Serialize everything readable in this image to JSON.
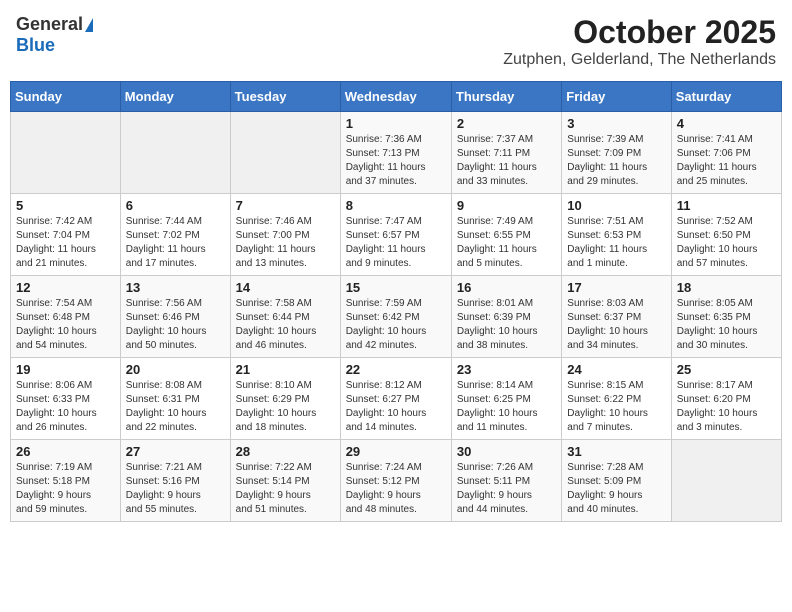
{
  "logo": {
    "general": "General",
    "blue": "Blue"
  },
  "title": "October 2025",
  "subtitle": "Zutphen, Gelderland, The Netherlands",
  "days_of_week": [
    "Sunday",
    "Monday",
    "Tuesday",
    "Wednesday",
    "Thursday",
    "Friday",
    "Saturday"
  ],
  "weeks": [
    [
      {
        "day": "",
        "info": ""
      },
      {
        "day": "",
        "info": ""
      },
      {
        "day": "",
        "info": ""
      },
      {
        "day": "1",
        "info": "Sunrise: 7:36 AM\nSunset: 7:13 PM\nDaylight: 11 hours\nand 37 minutes."
      },
      {
        "day": "2",
        "info": "Sunrise: 7:37 AM\nSunset: 7:11 PM\nDaylight: 11 hours\nand 33 minutes."
      },
      {
        "day": "3",
        "info": "Sunrise: 7:39 AM\nSunset: 7:09 PM\nDaylight: 11 hours\nand 29 minutes."
      },
      {
        "day": "4",
        "info": "Sunrise: 7:41 AM\nSunset: 7:06 PM\nDaylight: 11 hours\nand 25 minutes."
      }
    ],
    [
      {
        "day": "5",
        "info": "Sunrise: 7:42 AM\nSunset: 7:04 PM\nDaylight: 11 hours\nand 21 minutes."
      },
      {
        "day": "6",
        "info": "Sunrise: 7:44 AM\nSunset: 7:02 PM\nDaylight: 11 hours\nand 17 minutes."
      },
      {
        "day": "7",
        "info": "Sunrise: 7:46 AM\nSunset: 7:00 PM\nDaylight: 11 hours\nand 13 minutes."
      },
      {
        "day": "8",
        "info": "Sunrise: 7:47 AM\nSunset: 6:57 PM\nDaylight: 11 hours\nand 9 minutes."
      },
      {
        "day": "9",
        "info": "Sunrise: 7:49 AM\nSunset: 6:55 PM\nDaylight: 11 hours\nand 5 minutes."
      },
      {
        "day": "10",
        "info": "Sunrise: 7:51 AM\nSunset: 6:53 PM\nDaylight: 11 hours\nand 1 minute."
      },
      {
        "day": "11",
        "info": "Sunrise: 7:52 AM\nSunset: 6:50 PM\nDaylight: 10 hours\nand 57 minutes."
      }
    ],
    [
      {
        "day": "12",
        "info": "Sunrise: 7:54 AM\nSunset: 6:48 PM\nDaylight: 10 hours\nand 54 minutes."
      },
      {
        "day": "13",
        "info": "Sunrise: 7:56 AM\nSunset: 6:46 PM\nDaylight: 10 hours\nand 50 minutes."
      },
      {
        "day": "14",
        "info": "Sunrise: 7:58 AM\nSunset: 6:44 PM\nDaylight: 10 hours\nand 46 minutes."
      },
      {
        "day": "15",
        "info": "Sunrise: 7:59 AM\nSunset: 6:42 PM\nDaylight: 10 hours\nand 42 minutes."
      },
      {
        "day": "16",
        "info": "Sunrise: 8:01 AM\nSunset: 6:39 PM\nDaylight: 10 hours\nand 38 minutes."
      },
      {
        "day": "17",
        "info": "Sunrise: 8:03 AM\nSunset: 6:37 PM\nDaylight: 10 hours\nand 34 minutes."
      },
      {
        "day": "18",
        "info": "Sunrise: 8:05 AM\nSunset: 6:35 PM\nDaylight: 10 hours\nand 30 minutes."
      }
    ],
    [
      {
        "day": "19",
        "info": "Sunrise: 8:06 AM\nSunset: 6:33 PM\nDaylight: 10 hours\nand 26 minutes."
      },
      {
        "day": "20",
        "info": "Sunrise: 8:08 AM\nSunset: 6:31 PM\nDaylight: 10 hours\nand 22 minutes."
      },
      {
        "day": "21",
        "info": "Sunrise: 8:10 AM\nSunset: 6:29 PM\nDaylight: 10 hours\nand 18 minutes."
      },
      {
        "day": "22",
        "info": "Sunrise: 8:12 AM\nSunset: 6:27 PM\nDaylight: 10 hours\nand 14 minutes."
      },
      {
        "day": "23",
        "info": "Sunrise: 8:14 AM\nSunset: 6:25 PM\nDaylight: 10 hours\nand 11 minutes."
      },
      {
        "day": "24",
        "info": "Sunrise: 8:15 AM\nSunset: 6:22 PM\nDaylight: 10 hours\nand 7 minutes."
      },
      {
        "day": "25",
        "info": "Sunrise: 8:17 AM\nSunset: 6:20 PM\nDaylight: 10 hours\nand 3 minutes."
      }
    ],
    [
      {
        "day": "26",
        "info": "Sunrise: 7:19 AM\nSunset: 5:18 PM\nDaylight: 9 hours\nand 59 minutes."
      },
      {
        "day": "27",
        "info": "Sunrise: 7:21 AM\nSunset: 5:16 PM\nDaylight: 9 hours\nand 55 minutes."
      },
      {
        "day": "28",
        "info": "Sunrise: 7:22 AM\nSunset: 5:14 PM\nDaylight: 9 hours\nand 51 minutes."
      },
      {
        "day": "29",
        "info": "Sunrise: 7:24 AM\nSunset: 5:12 PM\nDaylight: 9 hours\nand 48 minutes."
      },
      {
        "day": "30",
        "info": "Sunrise: 7:26 AM\nSunset: 5:11 PM\nDaylight: 9 hours\nand 44 minutes."
      },
      {
        "day": "31",
        "info": "Sunrise: 7:28 AM\nSunset: 5:09 PM\nDaylight: 9 hours\nand 40 minutes."
      },
      {
        "day": "",
        "info": ""
      }
    ]
  ]
}
